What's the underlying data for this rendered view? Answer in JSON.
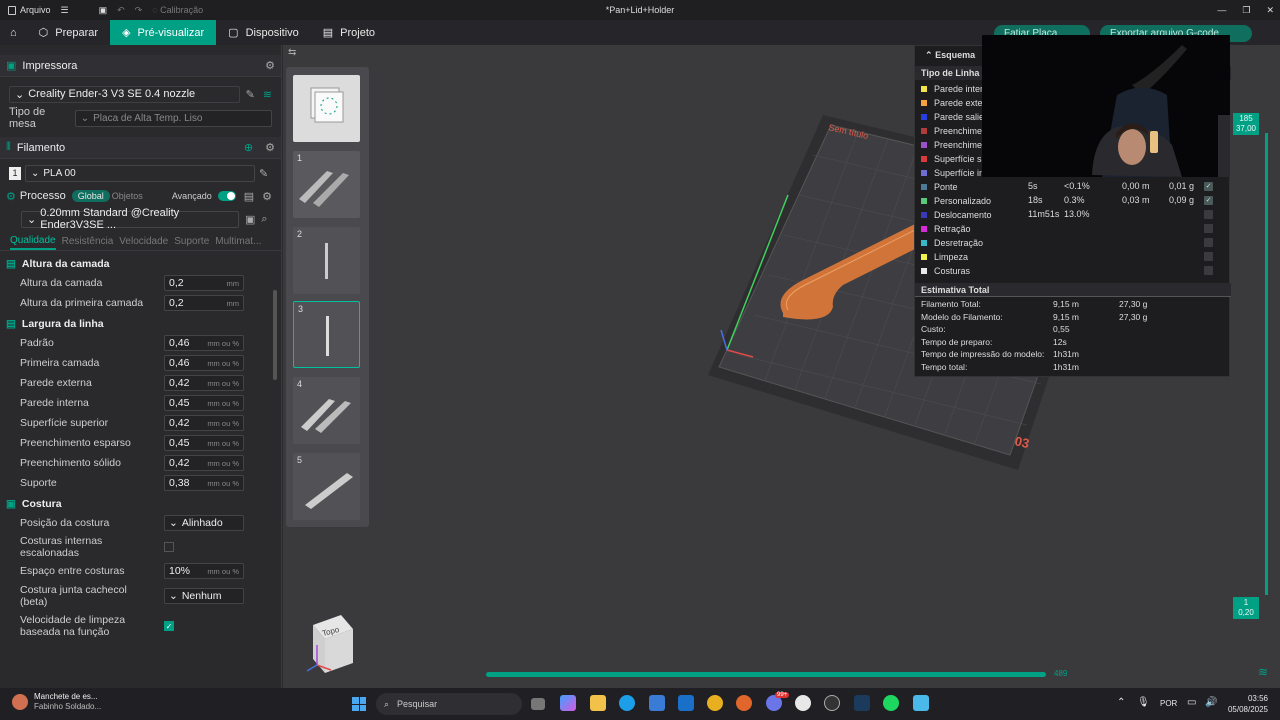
{
  "titlebar": {
    "file_label": "Arquivo",
    "calibration_label": "Calibração",
    "title": "*Pan+Lid+Holder"
  },
  "menu": {
    "prepare": "Preparar",
    "preview": "Pré-visualizar",
    "device": "Dispositivo",
    "project": "Projeto",
    "slice": "Fatiar Placa",
    "export": "Exportar arquivo G-code"
  },
  "printer": {
    "section": "Impressora",
    "name": "Creality Ender-3 V3 SE 0.4 nozzle",
    "bed_label": "Tipo de mesa",
    "bed_value": "Placa de Alta Temp. Liso"
  },
  "filament": {
    "section": "Filamento",
    "slot": "1",
    "name": "PLA 00"
  },
  "process": {
    "section": "Processo",
    "tag_global": "Global",
    "tag_objects": "Objetos",
    "advanced": "Avançado",
    "profile": "0.20mm Standard @Creality Ender3V3SE ..."
  },
  "tabs": [
    "Qualidade",
    "Resistência",
    "Velocidade",
    "Suporte",
    "Multimat..."
  ],
  "groups": {
    "layer_height": {
      "title": "Altura da camada",
      "params": [
        {
          "label": "Altura da camada",
          "value": "0,2",
          "unit": "mm"
        },
        {
          "label": "Altura da primeira camada",
          "value": "0,2",
          "unit": "mm"
        }
      ]
    },
    "line_width": {
      "title": "Largura da linha",
      "params": [
        {
          "label": "Padrão",
          "value": "0,46",
          "unit": "mm ou %"
        },
        {
          "label": "Primeira camada",
          "value": "0,46",
          "unit": "mm ou %"
        },
        {
          "label": "Parede externa",
          "value": "0,42",
          "unit": "mm ou %"
        },
        {
          "label": "Parede interna",
          "value": "0,45",
          "unit": "mm ou %"
        },
        {
          "label": "Superfície superior",
          "value": "0,42",
          "unit": "mm ou %"
        },
        {
          "label": "Preenchimento esparso",
          "value": "0,45",
          "unit": "mm ou %"
        },
        {
          "label": "Preenchimento sólido",
          "value": "0,42",
          "unit": "mm ou %"
        },
        {
          "label": "Suporte",
          "value": "0,38",
          "unit": "mm ou %"
        }
      ]
    },
    "seam": {
      "title": "Costura",
      "position_label": "Posição da costura",
      "position_value": "Alinhado",
      "staggered_label": "Costuras internas escalonadas",
      "gap_label": "Espaço entre costuras",
      "gap_value": "10%",
      "gap_unit": "mm ou %",
      "scarf_label": "Costura junta cachecol (beta)",
      "scarf_value": "Nenhum",
      "wipe_label": "Velocidade de limpeza baseada na função"
    }
  },
  "plates": [
    "1",
    "2",
    "3",
    "4",
    "5"
  ],
  "viewport": {
    "plate_name": "Sem título",
    "plate_number": "03",
    "top_label": "185",
    "top_value": "37,00",
    "bottom_label": "1",
    "bottom_value": "0,20",
    "layer_slider_value": "489",
    "cube_label": "Topo"
  },
  "legend": {
    "title": "Esquema",
    "line_type": "Tipo de Linha",
    "rows": [
      {
        "name": "Parede inter",
        "color": "#f2e24c"
      },
      {
        "name": "Parede exter",
        "color": "#f7a241"
      },
      {
        "name": "Parede salie",
        "color": "#2a3de0"
      },
      {
        "name": "Preenchimer",
        "color": "#b23b3b"
      },
      {
        "name": "Preenchimer",
        "color": "#9b52c8"
      },
      {
        "name": "Superfície su",
        "color": "#d93b3b"
      },
      {
        "name": "Superfície in",
        "color": "#6e6ed6"
      },
      {
        "name": "Ponte",
        "color": "#4e7a98",
        "time": "5s",
        "pct": "<0.1%",
        "len": "0,00 m",
        "weight": "0,01 g"
      },
      {
        "name": "Personalizado",
        "color": "#5ac87a",
        "time": "18s",
        "pct": "0.3%",
        "len": "0,03 m",
        "weight": "0,09 g"
      },
      {
        "name": "Deslocamento",
        "color": "#3a3ab8",
        "time": "11m51s",
        "pct": "13.0%"
      },
      {
        "name": "Retração",
        "color": "#d92ad9"
      },
      {
        "name": "Desretração",
        "color": "#3ab8c8"
      },
      {
        "name": "Limpeza",
        "color": "#f2f24c"
      },
      {
        "name": "Costuras",
        "color": "#e8e8e8"
      }
    ],
    "total_title": "Estimativa Total",
    "totals": [
      {
        "label": "Filamento Total:",
        "a": "9,15 m",
        "b": "27,30 g"
      },
      {
        "label": "Modelo do Filamento:",
        "a": "9,15 m",
        "b": "27,30 g"
      },
      {
        "label": "Custo:",
        "a": "0,55",
        "b": ""
      },
      {
        "label": "Tempo de preparo:",
        "a": "12s",
        "b": ""
      },
      {
        "label": "Tempo de impressão do modelo:",
        "a": "1h31m",
        "b": ""
      },
      {
        "label": "Tempo total:",
        "a": "1h31m",
        "b": ""
      }
    ]
  },
  "taskbar": {
    "news_title": "Manchete de es...",
    "news_sub": "Fabinho Soldado...",
    "search": "Pesquisar",
    "lang": "POR",
    "time": "03:56",
    "date": "05/08/2025",
    "badge": "99+"
  }
}
